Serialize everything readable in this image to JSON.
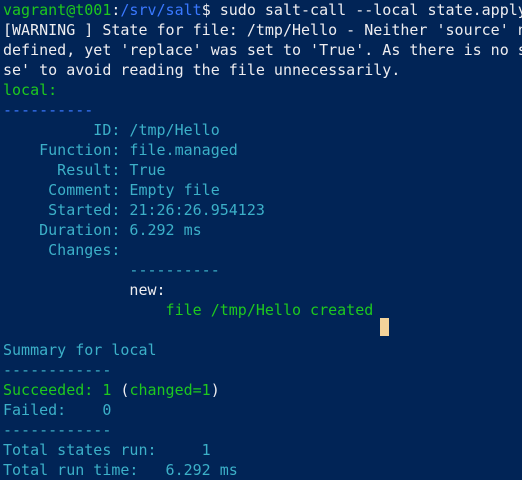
{
  "colors": {
    "background": "#012456",
    "text": "#eeedf0",
    "green": "#1ec91e",
    "blue": "#3a78ff",
    "cyan": "#3cb0c8",
    "red": "#c83232",
    "cursor": "#f3d39a"
  },
  "prompt": {
    "user_host": "vagrant@t001",
    "colon": ":",
    "path": "/srv/salt",
    "symbol": "$",
    "command": " sudo salt-call --local state.apply"
  },
  "warning": {
    "line1": "[WARNING ] State for file: /tmp/Hello - Neither 'source' n",
    "line2": "defined, yet 'replace' was set to 'True'. As there is no s",
    "line3": "se' to avoid reading the file unnecessarily."
  },
  "result": {
    "host": "local:",
    "sep1": "----------",
    "id_label": "          ID:",
    "id_value": " /tmp/Hello",
    "function_label": "    Function:",
    "function_value": " file.managed",
    "result_label": "      Result:",
    "result_value": " True",
    "comment_label": "     Comment:",
    "comment_value": " Empty file",
    "started_label": "     Started:",
    "started_value": " 21:26:26.954123",
    "duration_label": "    Duration:",
    "duration_value": " 6.292 ms",
    "changes_label": "     Changes:",
    "changes_sep": "              ----------",
    "new_label": "              new:",
    "new_value": "                  file /tmp/Hello created"
  },
  "summary": {
    "title": "Summary for local",
    "sep1": "------------",
    "succeeded_label": "Succeeded: 1",
    "succeeded_open": " (",
    "succeeded_changed": "changed=1",
    "succeeded_close": ")",
    "failed_label": "Failed:    0",
    "sep2": "------------",
    "total_states": "Total states run:     1",
    "total_time": "Total run time:   6.292 ms"
  }
}
